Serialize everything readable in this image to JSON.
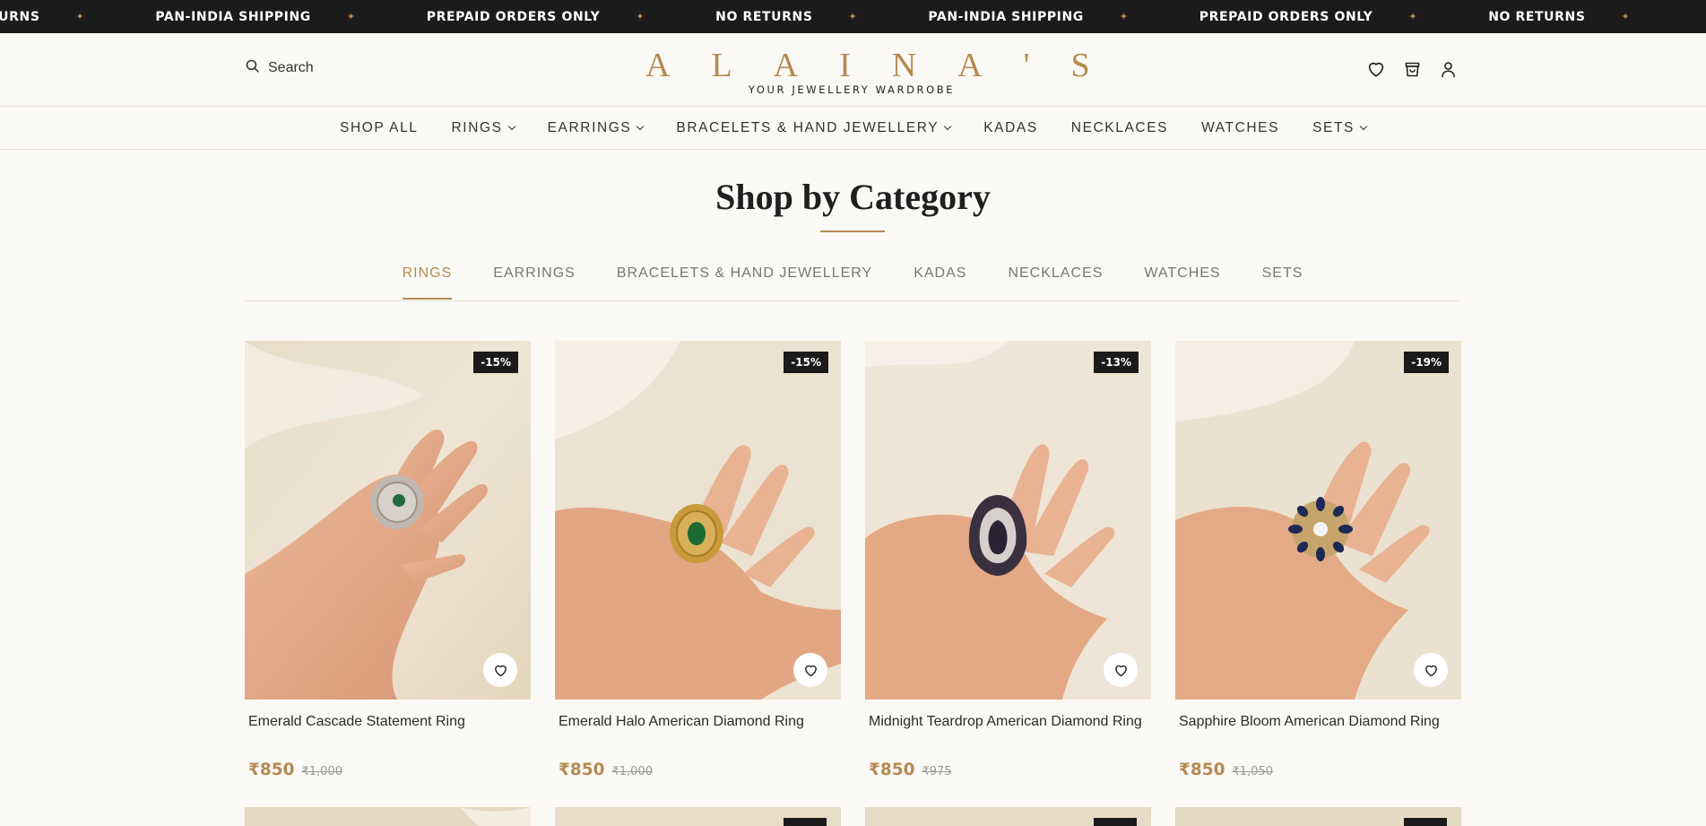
{
  "announcement": {
    "items": [
      "TURNS",
      "PAN-INDIA SHIPPING",
      "PREPAID ORDERS ONLY",
      "NO RETURNS",
      "PAN-INDIA SHIPPING",
      "PREPAID ORDERS ONLY",
      "NO RETURNS"
    ],
    "separator": "✦"
  },
  "header": {
    "search_label": "Search",
    "logo_name": "ALAINA'S",
    "logo_tagline": "YOUR JEWELLERY WARDROBE",
    "icons": [
      "heart-icon",
      "bag-icon",
      "user-icon"
    ]
  },
  "main_nav": {
    "items": [
      {
        "label": "SHOP ALL",
        "dropdown": false
      },
      {
        "label": "RINGS",
        "dropdown": true
      },
      {
        "label": "EARRINGS",
        "dropdown": true
      },
      {
        "label": "BRACELETS & HAND JEWELLERY",
        "dropdown": true
      },
      {
        "label": "KADAS",
        "dropdown": false
      },
      {
        "label": "NECKLACES",
        "dropdown": false
      },
      {
        "label": "WATCHES",
        "dropdown": false
      },
      {
        "label": "SETS",
        "dropdown": true
      }
    ]
  },
  "section": {
    "title": "Shop by Category",
    "tabs": [
      "RINGS",
      "EARRINGS",
      "BRACELETS & HAND JEWELLERY",
      "KADAS",
      "NECKLACES",
      "WATCHES",
      "SETS"
    ],
    "active_tab": "RINGS"
  },
  "products": [
    {
      "name": "Emerald Cascade Statement Ring",
      "price": "₹850",
      "compare_price": "₹1,000",
      "discount": "-15%"
    },
    {
      "name": "Emerald Halo American Diamond Ring",
      "price": "₹850",
      "compare_price": "₹1,000",
      "discount": "-15%"
    },
    {
      "name": "Midnight Teardrop American Diamond Ring",
      "price": "₹850",
      "compare_price": "₹975",
      "discount": "-13%"
    },
    {
      "name": "Sapphire Bloom American Diamond Ring",
      "price": "₹850",
      "compare_price": "₹1,050",
      "discount": "-19%"
    }
  ],
  "colors": {
    "accent": "#b48a52",
    "dark": "#1b1b1b",
    "background": "#fbf9f5"
  }
}
